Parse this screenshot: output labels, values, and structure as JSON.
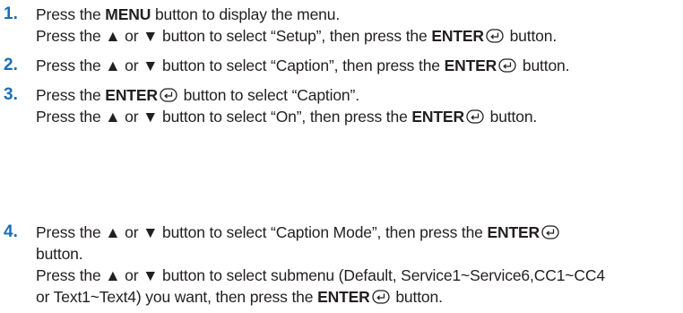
{
  "steps": [
    {
      "number": "1.",
      "lines": [
        [
          {
            "text": "Press the "
          },
          {
            "text": "MENU",
            "bold": true
          },
          {
            "text": " button to display the menu."
          }
        ],
        [
          {
            "text": "Press the ▲ or ▼ button to select “Setup”, then press the "
          },
          {
            "text": "ENTER",
            "bold": true
          },
          {
            "icon": "enter-icon"
          },
          {
            "text": " button."
          }
        ]
      ]
    },
    {
      "number": "2.",
      "lines": [
        [
          {
            "text": "Press the ▲ or ▼ button to select “Caption”, then press the "
          },
          {
            "text": "ENTER",
            "bold": true
          },
          {
            "icon": "enter-icon"
          },
          {
            "text": " button."
          }
        ]
      ]
    },
    {
      "number": "3.",
      "lines": [
        [
          {
            "text": "Press the "
          },
          {
            "text": "ENTER",
            "bold": true
          },
          {
            "icon": "enter-icon"
          },
          {
            "text": " button to select “Caption”."
          }
        ],
        [
          {
            "text": "Press the ▲ or ▼ button to select “On”, then press the "
          },
          {
            "text": "ENTER",
            "bold": true
          },
          {
            "icon": "enter-icon"
          },
          {
            "text": " button."
          }
        ]
      ]
    },
    {
      "number": "4.",
      "lines": [
        [
          {
            "text": "Press the ▲ or ▼ button to select “Caption Mode”, then press the "
          },
          {
            "text": "ENTER",
            "bold": true
          },
          {
            "icon": "enter-icon"
          }
        ],
        [
          {
            "text": "button."
          }
        ],
        [
          {
            "text": "Press the ▲ or ▼ button to select submenu (Default, Service1~Service6,CC1~CC4"
          }
        ],
        [
          {
            "text": "or Text1~Text4) you want, then press the "
          },
          {
            "text": "ENTER",
            "bold": true
          },
          {
            "icon": "enter-icon"
          },
          {
            "text": " button."
          }
        ]
      ]
    }
  ],
  "colors": {
    "step_number": "#1a6fb4",
    "text": "#231f20"
  }
}
